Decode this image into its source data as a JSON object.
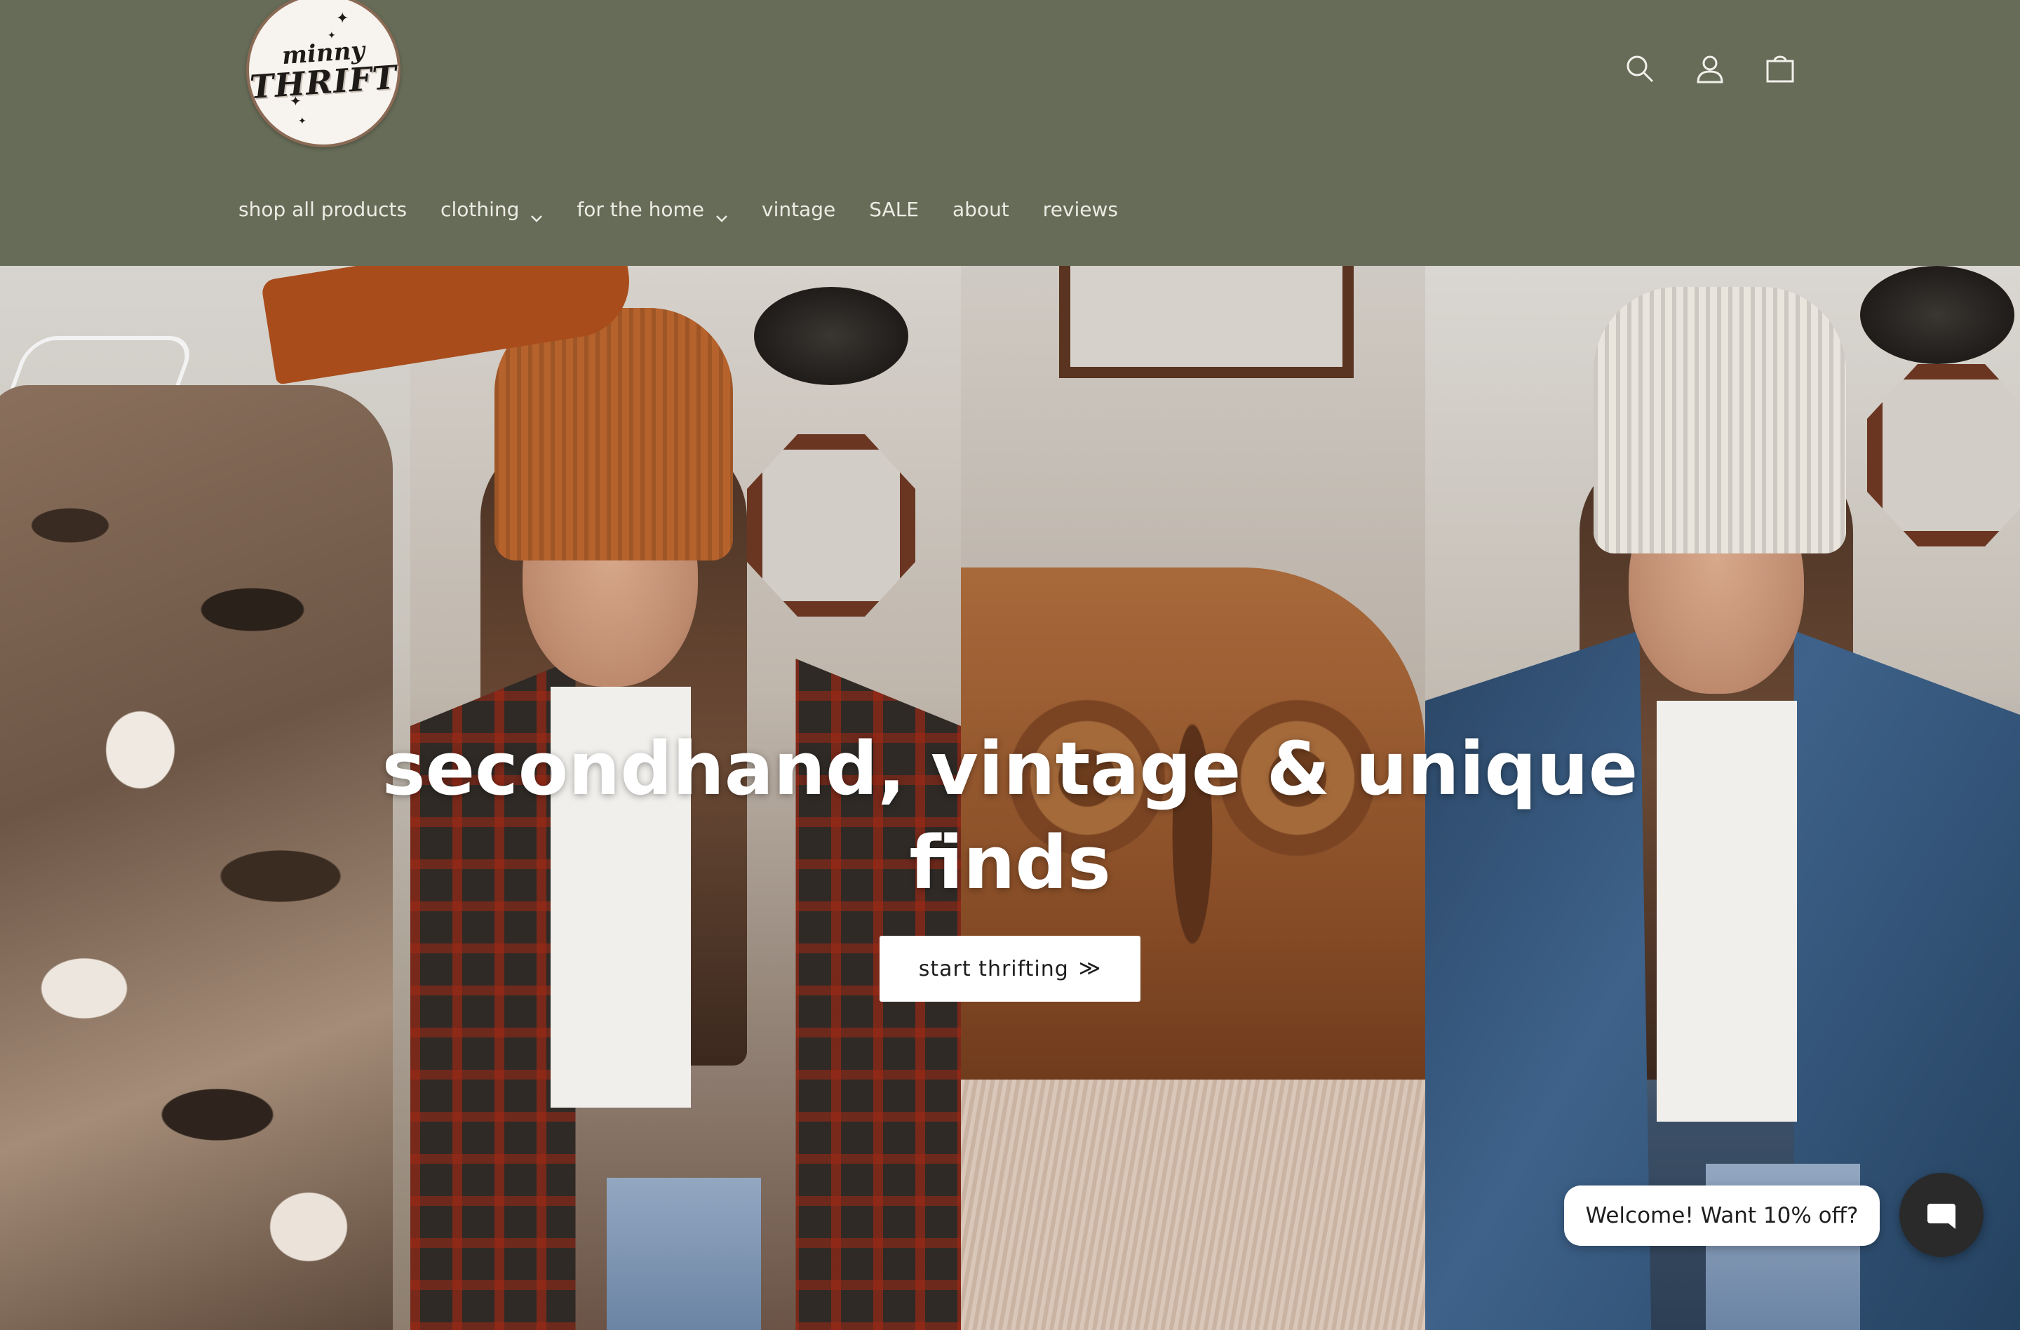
{
  "header": {
    "logo": {
      "top_text": "minny",
      "bottom_text": "THRIFT"
    },
    "icons": [
      "search-icon",
      "account-icon",
      "cart-icon"
    ],
    "background_color": "#676c58"
  },
  "nav": {
    "items": [
      {
        "label": "shop all products",
        "has_dropdown": false
      },
      {
        "label": "clothing",
        "has_dropdown": true
      },
      {
        "label": "for the home",
        "has_dropdown": true
      },
      {
        "label": "vintage",
        "has_dropdown": false
      },
      {
        "label": "SALE",
        "has_dropdown": false
      },
      {
        "label": "about",
        "has_dropdown": false
      },
      {
        "label": "reviews",
        "has_dropdown": false
      }
    ]
  },
  "hero": {
    "title": "secondhand, vintage & unique finds",
    "cta_label": "start thrifting",
    "cta_icon": "double-chevron-right-icon"
  },
  "chat": {
    "bubble_text": "Welcome! Want 10% off?",
    "button_icon": "chat-icon"
  }
}
